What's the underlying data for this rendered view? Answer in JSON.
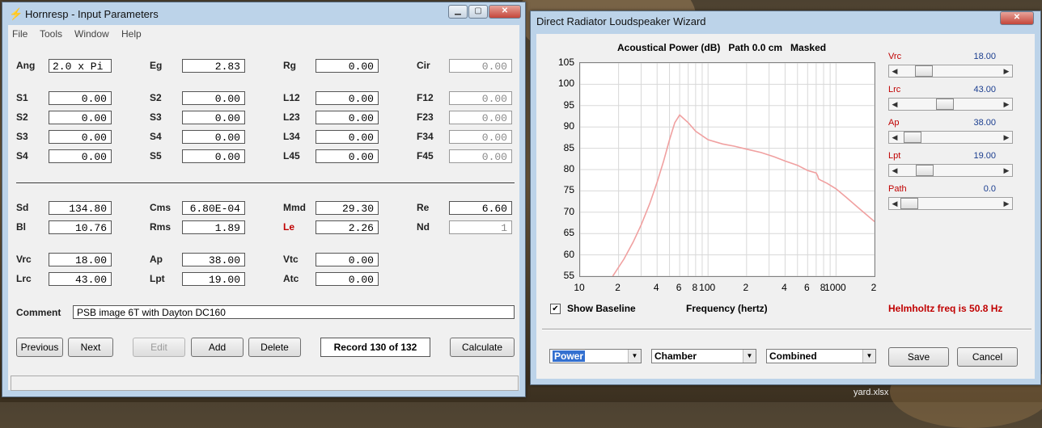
{
  "desktop": {
    "file_label": "yard.xlsx"
  },
  "hornresp": {
    "title": "Hornresp - Input Parameters",
    "menu": [
      "File",
      "Tools",
      "Window",
      "Help"
    ],
    "rows1": [
      [
        {
          "l": "Ang",
          "v": "2.0 x Pi"
        },
        {
          "l": "Eg",
          "v": "2.83"
        },
        {
          "l": "Rg",
          "v": "0.00"
        },
        {
          "l": "Cir",
          "v": "0.00"
        }
      ],
      [
        {
          "l": "S1",
          "v": "0.00"
        },
        {
          "l": "S2",
          "v": "0.00"
        },
        {
          "l": "L12",
          "v": "0.00"
        },
        {
          "l": "F12",
          "v": "0.00"
        }
      ],
      [
        {
          "l": "S2",
          "v": "0.00"
        },
        {
          "l": "S3",
          "v": "0.00"
        },
        {
          "l": "L23",
          "v": "0.00"
        },
        {
          "l": "F23",
          "v": "0.00"
        }
      ],
      [
        {
          "l": "S3",
          "v": "0.00"
        },
        {
          "l": "S4",
          "v": "0.00"
        },
        {
          "l": "L34",
          "v": "0.00"
        },
        {
          "l": "F34",
          "v": "0.00"
        }
      ],
      [
        {
          "l": "S4",
          "v": "0.00"
        },
        {
          "l": "S5",
          "v": "0.00"
        },
        {
          "l": "L45",
          "v": "0.00"
        },
        {
          "l": "F45",
          "v": "0.00"
        }
      ]
    ],
    "rows2": [
      [
        {
          "l": "Sd",
          "v": "134.80"
        },
        {
          "l": "Cms",
          "v": "6.80E-04"
        },
        {
          "l": "Mmd",
          "v": "29.30"
        },
        {
          "l": "Re",
          "v": "6.60"
        }
      ],
      [
        {
          "l": "Bl",
          "v": "10.76"
        },
        {
          "l": "Rms",
          "v": "1.89"
        },
        {
          "l": "Le",
          "v": "2.26"
        },
        {
          "l": "Nd",
          "v": "1"
        }
      ]
    ],
    "rows3": [
      [
        {
          "l": "Vrc",
          "v": "18.00"
        },
        {
          "l": "Ap",
          "v": "38.00"
        },
        {
          "l": "Vtc",
          "v": "0.00"
        }
      ],
      [
        {
          "l": "Lrc",
          "v": "43.00"
        },
        {
          "l": "Lpt",
          "v": "19.00"
        },
        {
          "l": "Atc",
          "v": "0.00"
        }
      ]
    ],
    "comment_label": "Comment",
    "comment_value": "PSB image 6T with Dayton DC160",
    "buttons": [
      "Previous",
      "Next",
      "Edit",
      "Add",
      "Delete",
      "Calculate"
    ],
    "record": "Record 130 of 132"
  },
  "wizard": {
    "title": "Direct Radiator Loudspeaker Wizard",
    "chart_title": "Acoustical Power (dB)   Path 0.0 cm   Masked",
    "show_baseline": "Show Baseline",
    "helmholtz": "Helmholtz freq is 50.8 Hz",
    "sliders": [
      {
        "label": "Vrc",
        "value": "18.00",
        "pos": 0.18
      },
      {
        "label": "Lrc",
        "value": "43.00",
        "pos": 0.43
      },
      {
        "label": "Ap",
        "value": "38.00",
        "pos": 0.04
      },
      {
        "label": "Lpt",
        "value": "19.00",
        "pos": 0.19
      },
      {
        "label": "Path",
        "value": "0.0",
        "pos": 0.0
      }
    ],
    "combos": [
      "Power",
      "Chamber",
      "Combined"
    ],
    "save": "Save",
    "cancel": "Cancel",
    "colors": {
      "curve": "#f0a0a0",
      "label_red": "#c00000",
      "value_blue": "#1a3d8f"
    }
  },
  "chart_data": {
    "type": "line",
    "title": "Acoustical Power (dB)   Path 0.0 cm   Masked",
    "xlabel": "Frequency (hertz)",
    "ylabel": "",
    "x_scale": "log",
    "xlim": [
      10,
      2000
    ],
    "ylim": [
      55,
      105
    ],
    "x_ticks": [
      "10",
      "2",
      "4",
      "6",
      "8",
      "100",
      "2",
      "4",
      "6",
      "8",
      "1000",
      "2"
    ],
    "y_ticks": [
      "105",
      "100",
      "95",
      "90",
      "85",
      "80",
      "75",
      "70",
      "65",
      "60",
      "55"
    ],
    "grid": true,
    "series": [
      {
        "x": [
          18,
          22,
          26,
          30,
          35,
          40,
          45,
          50,
          55,
          60,
          70,
          80,
          100,
          130,
          160,
          200,
          260,
          330,
          400,
          500,
          600,
          700,
          720,
          730,
          760,
          850,
          1000,
          1200,
          1500,
          2000
        ],
        "y": [
          55,
          59,
          63,
          67,
          72,
          77,
          82,
          87,
          91,
          92.8,
          91,
          89,
          87,
          86,
          85.5,
          84.8,
          84,
          83,
          82,
          81,
          79.8,
          79.2,
          78.5,
          77.8,
          77.5,
          76.8,
          75.5,
          73.5,
          71,
          67.8
        ]
      }
    ]
  }
}
